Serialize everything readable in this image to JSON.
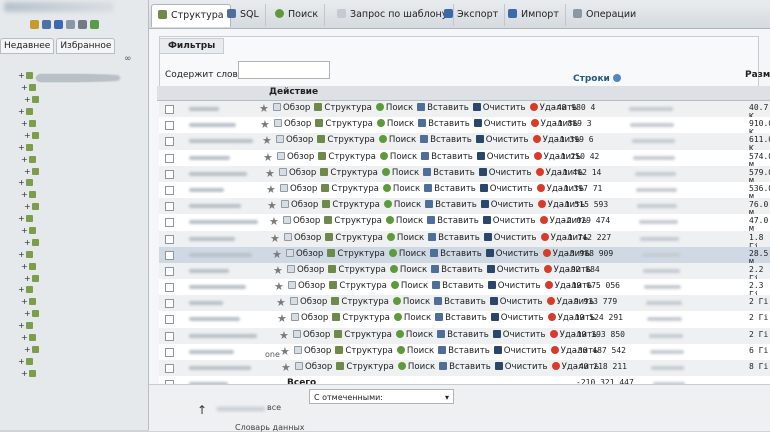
{
  "sidebar": {
    "tabs": [
      "Недавнее",
      "Избранное"
    ],
    "tree_count": 26
  },
  "tabs": [
    {
      "label": "Структура",
      "icon": "structure-icon",
      "active": true
    },
    {
      "label": "SQL",
      "icon": "sql-icon",
      "active": false
    },
    {
      "label": "Поиск",
      "icon": "search-icon",
      "active": false
    },
    {
      "label": "Запрос по шаблону",
      "icon": "query-icon",
      "active": false
    },
    {
      "label": "Экспорт",
      "icon": "export-icon",
      "active": false
    },
    {
      "label": "Импорт",
      "icon": "import-icon",
      "active": false
    },
    {
      "label": "Операции",
      "icon": "operations-icon",
      "active": false
    }
  ],
  "filters": {
    "legend": "Фильтры",
    "contains_label": "Содержит слово:",
    "contains_value": ""
  },
  "table": {
    "col_action": "Действие",
    "col_rows": "Строки",
    "col_size": "Размер",
    "action_labels": {
      "browse": "Обзор",
      "structure": "Структура",
      "search": "Поиск",
      "insert": "Вставить",
      "empty": "Очистить",
      "drop": "Удалить"
    },
    "rows": [
      {
        "rows": "-48 980 4",
        "size": "40.7 K"
      },
      {
        "rows": "-1 889 3",
        "size": "910.0 K"
      },
      {
        "rows": "-1 399 6",
        "size": "611.0 K"
      },
      {
        "rows": "-1 250 42",
        "size": "574.0 M"
      },
      {
        "rows": "-1 402 14",
        "size": "579.0 M"
      },
      {
        "rows": "-1 397 71",
        "size": "536.0 M"
      },
      {
        "rows": "-1 515 593",
        "size": "76.0 M"
      },
      {
        "rows": "-2 029 474",
        "size": "47.0 M"
      },
      {
        "rows": "-1 742 227",
        "size": "1.8 Гi"
      },
      {
        "rows": "-3 988 909",
        "size": "28.5 M"
      },
      {
        "rows": "-92 884",
        "size": "2.2 Гi"
      },
      {
        "rows": "-19 075 056",
        "size": "2.3 Гi"
      },
      {
        "rows": "-9 933 779",
        "size": "2 Гi"
      },
      {
        "rows": "-19 524 291",
        "size": "2 Гi"
      },
      {
        "rows": "-19 393 850",
        "size": "2 Гi"
      },
      {
        "rows": "-36 487 542",
        "size": "6 Гi"
      },
      {
        "rows": "-40 218 211",
        "size": "8 Гi"
      },
      {
        "rows": "-210 321 447",
        "size": ""
      }
    ],
    "partial_label": "one",
    "total_label": "Всего"
  },
  "bottom": {
    "check_all": "все",
    "with_selected": "С отмеченными:",
    "dictionary": "Словарь данных"
  }
}
